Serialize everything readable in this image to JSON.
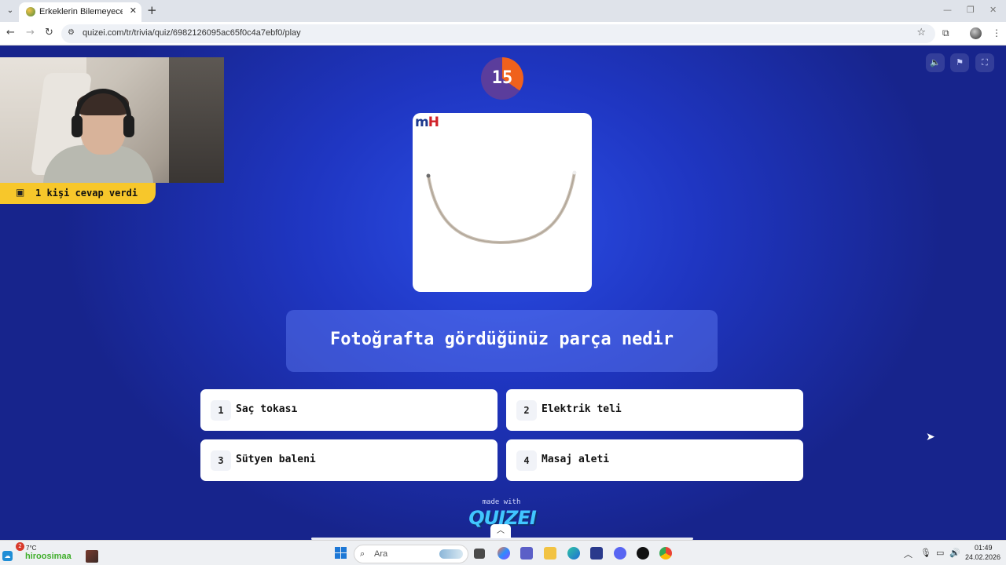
{
  "browser": {
    "tab_title": "Erkeklerin Bilemeyeceği Şeyler",
    "url": "quizei.com/tr/trivia/quiz/6982126095ac65f0c4a7ebf0/play"
  },
  "stream": {
    "answered_text": "1 kişi cevap verdi"
  },
  "quiz": {
    "timer": "15",
    "question": "Fotoğrafta gördüğünüz parça nedir",
    "image_logo_prefix": "m",
    "image_logo_suffix": "H",
    "answers": [
      {
        "num": "1",
        "label": "Saç tokası"
      },
      {
        "num": "2",
        "label": "Elektrik teli"
      },
      {
        "num": "3",
        "label": "Sütyen baleni"
      },
      {
        "num": "4",
        "label": "Masaj aleti"
      }
    ],
    "made_with": "made with",
    "brand": "QUIZEI"
  },
  "taskbar": {
    "weather_badge": "2",
    "weather_temp": "7°C",
    "stream_label": "hiroosimaa",
    "search_placeholder": "Ara",
    "time": "01:49",
    "date": "24.02.2026"
  },
  "colors": {
    "accent_orange": "#f0611c",
    "answer_bg": "#ffffff",
    "pill_yellow": "#f7c72b"
  }
}
